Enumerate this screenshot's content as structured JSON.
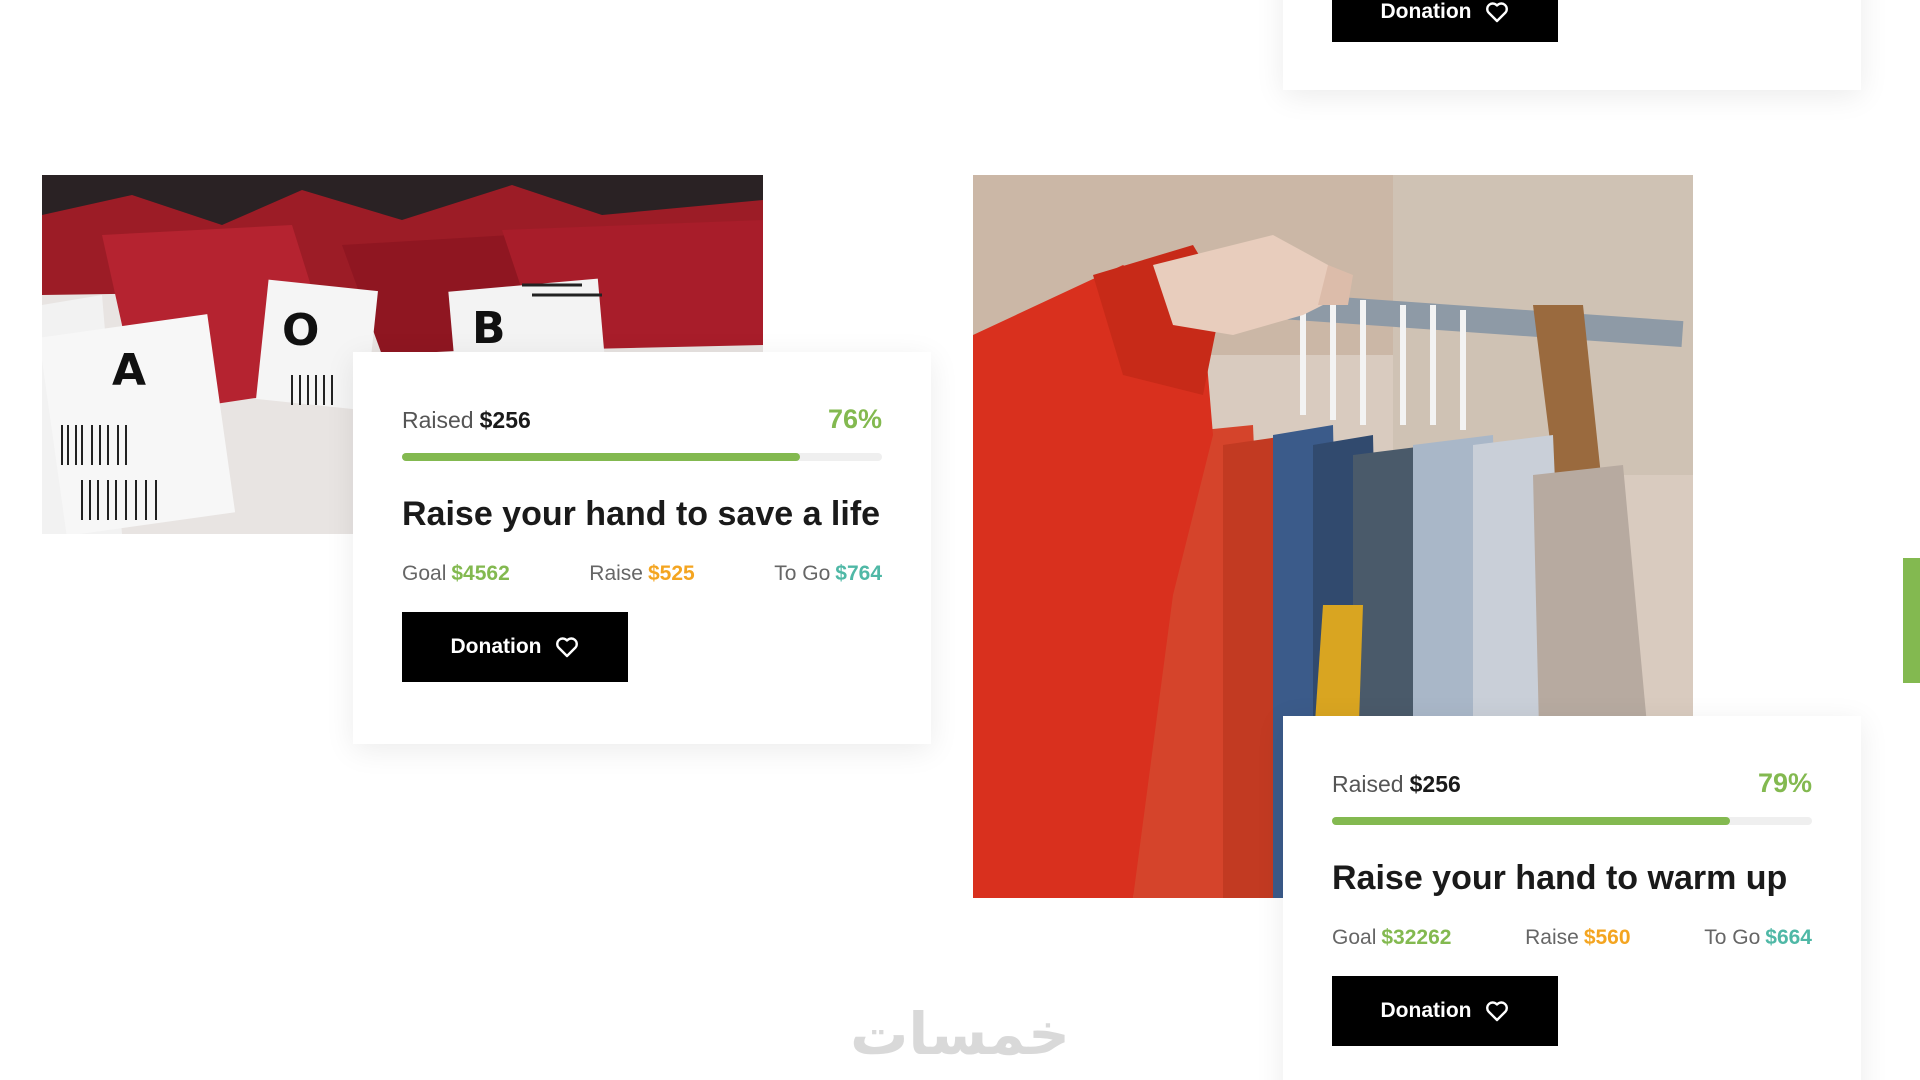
{
  "top_card": {
    "donate_label": "Donation"
  },
  "campaigns": [
    {
      "image_icon": "blood-bags-photo",
      "raised_label": "Raised",
      "raised_value": "$256",
      "percent": "76%",
      "progress": 0.83,
      "title": "Raise your hand to save a life",
      "goal_label": "Goal",
      "goal_value": "$4562",
      "raise_label": "Raise",
      "raise_value": "$525",
      "togo_label": "To Go",
      "togo_value": "$764",
      "donate_label": "Donation"
    },
    {
      "image_icon": "clothes-rack-photo",
      "raised_label": "Raised",
      "raised_value": "$256",
      "percent": "79%",
      "progress": 0.83,
      "title": "Raise your hand to warm up",
      "goal_label": "Goal",
      "goal_value": "$32262",
      "raise_label": "Raise",
      "raise_value": "$560",
      "togo_label": "To Go",
      "togo_value": "$664",
      "donate_label": "Donation"
    }
  ],
  "watermark": "خمسات",
  "colors": {
    "accent": "#83b950",
    "raise": "#f4a521",
    "togo": "#4fb8a6",
    "button": "#000000"
  }
}
